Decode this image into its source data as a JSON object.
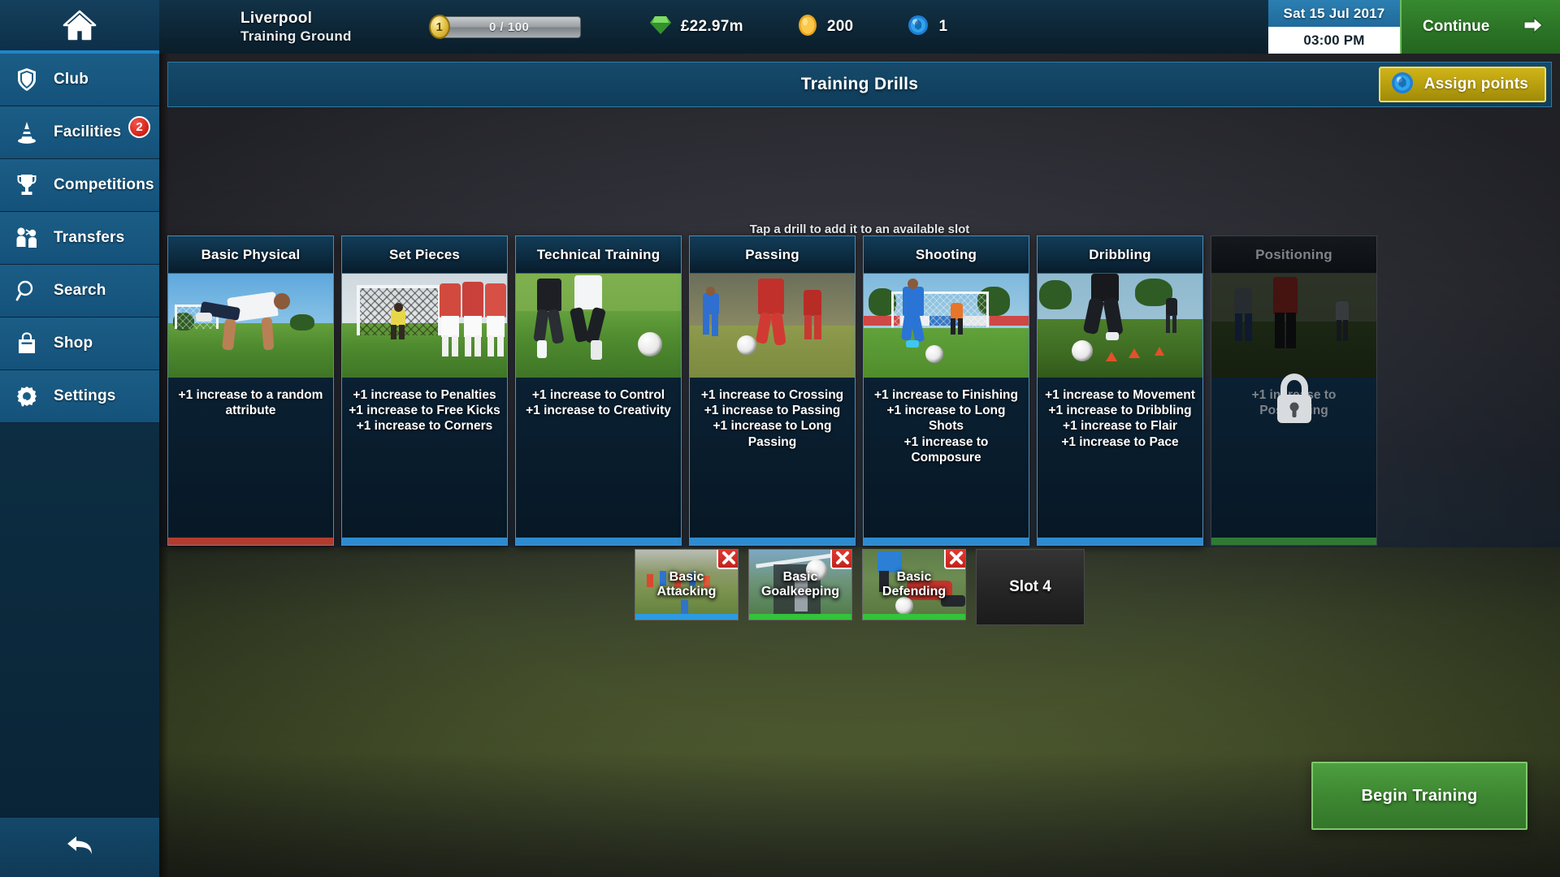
{
  "topbar": {
    "home_icon": "home-icon",
    "club_name": "Liverpool",
    "club_sub": "Training Ground",
    "xp": {
      "badge_level": "1",
      "value_text": "0 / 100"
    },
    "resources": [
      {
        "icon": "gem-icon",
        "value": "£22.97m"
      },
      {
        "icon": "coin-icon",
        "value": "200"
      },
      {
        "icon": "orb-icon",
        "value": "1"
      }
    ],
    "date": "Sat 15 Jul 2017",
    "time": "03:00 PM",
    "continue_label": "Continue",
    "continue_icon": "arrow-right-icon"
  },
  "sidebar": {
    "items": [
      {
        "label": "Club",
        "icon": "shield-icon",
        "badge": null
      },
      {
        "label": "Facilities",
        "icon": "cone-icon",
        "badge": "2"
      },
      {
        "label": "Competitions",
        "icon": "trophy-icon",
        "badge": null
      },
      {
        "label": "Transfers",
        "icon": "transfers-icon",
        "badge": null
      },
      {
        "label": "Search",
        "icon": "magnifier-icon",
        "badge": null
      },
      {
        "label": "Shop",
        "icon": "shopping-bag-icon",
        "badge": null
      },
      {
        "label": "Settings",
        "icon": "gear-icon",
        "badge": null
      }
    ],
    "back_icon": "back-arrow-icon"
  },
  "header": {
    "title": "Training Drills",
    "assign_points_label": "Assign points",
    "assign_points_icon": "orb-icon"
  },
  "main": {
    "hint": "Tap a drill to add it to an available slot",
    "drills": [
      {
        "title": "Basic Physical",
        "effects": [
          "+1 increase to a random attribute"
        ],
        "accent": "#b23c2e",
        "locked": false,
        "photo": "pushup-on-pitch"
      },
      {
        "title": "Set Pieces",
        "effects": [
          "+1 increase to Penalties",
          "+1 increase to Free Kicks",
          "+1 increase to Corners"
        ],
        "accent": "#2e8bd0",
        "locked": false,
        "photo": "free-kick-wall"
      },
      {
        "title": "Technical Training",
        "effects": [
          "+1 increase to Control",
          "+1 increase to Creativity"
        ],
        "accent": "#2e8bd0",
        "locked": false,
        "photo": "tackle-duel"
      },
      {
        "title": "Passing",
        "effects": [
          "+1 increase to Crossing",
          "+1 increase to Passing",
          "+1 increase to Long Passing"
        ],
        "accent": "#2e8bd0",
        "locked": false,
        "photo": "passing-drill"
      },
      {
        "title": "Shooting",
        "effects": [
          "+1 increase to Finishing",
          "+1 increase to Long Shots",
          "+1 increase to Composure"
        ],
        "accent": "#2e8bd0",
        "locked": false,
        "photo": "shot-on-goal"
      },
      {
        "title": "Dribbling",
        "effects": [
          "+1 increase to Movement",
          "+1 increase to Dribbling",
          "+1 increase to Flair",
          "+1 increase to Pace"
        ],
        "accent": "#2e8bd0",
        "locked": false,
        "photo": "cone-dribble"
      },
      {
        "title": "Positioning",
        "effects": [
          "+1 increase to Positioning"
        ],
        "accent": "#2f7a33",
        "locked": true,
        "lock_icon": "padlock-icon",
        "photo": "coaching-session"
      }
    ],
    "slots": [
      {
        "label": "Basic Attacking",
        "bar_color": "#2e9ae0",
        "remove_icon": "close-x-icon",
        "filled": true,
        "photo": "attacking-drill"
      },
      {
        "label": "Basic Goalkeeping",
        "bar_color": "#35c23c",
        "remove_icon": "close-x-icon",
        "filled": true,
        "photo": "goalkeeper-save"
      },
      {
        "label": "Basic Defending",
        "bar_color": "#35c23c",
        "remove_icon": "close-x-icon",
        "filled": true,
        "photo": "sliding-tackle"
      },
      {
        "label": "Slot 4",
        "filled": false
      }
    ],
    "begin_training_label": "Begin Training"
  }
}
